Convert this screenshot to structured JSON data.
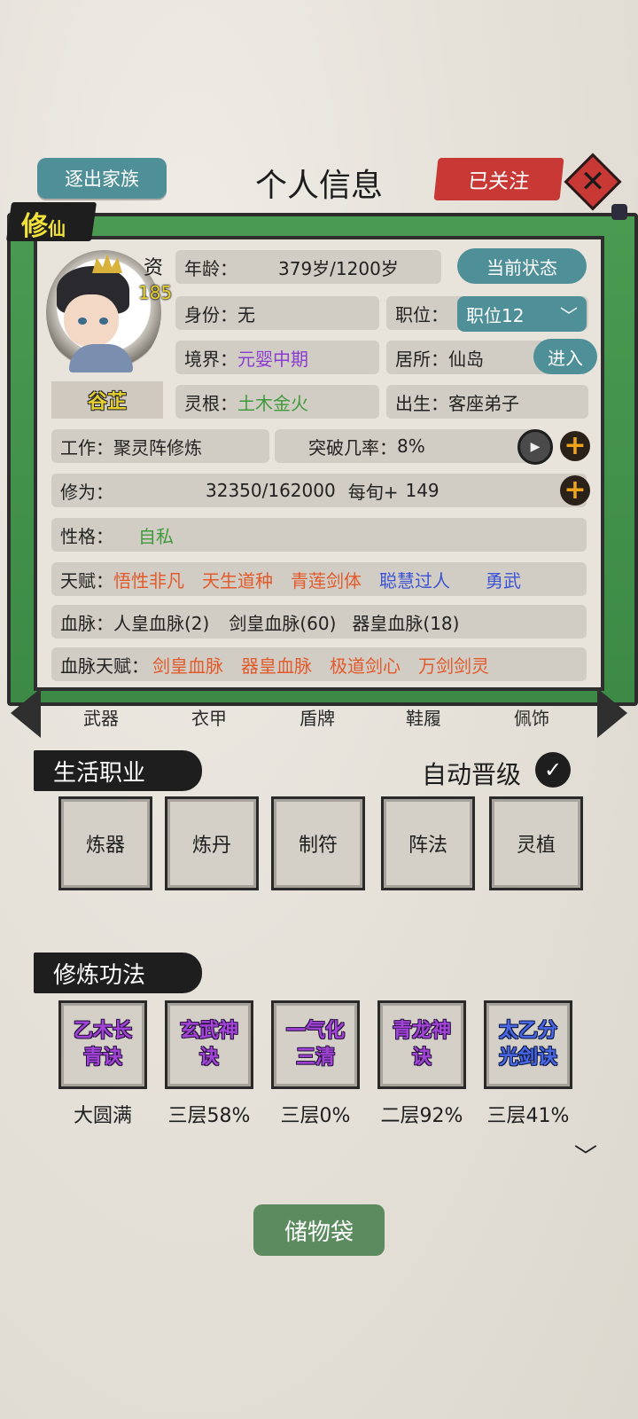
{
  "header": {
    "expel_label": "逐出家族",
    "title": "个人信息",
    "followed_label": "已关注",
    "close_icon": "close-icon"
  },
  "badge": {
    "main": "修",
    "sub": "仙"
  },
  "profile": {
    "aptitude_label": "资",
    "aptitude_value": "185",
    "name": "谷芷",
    "age_label": "年龄：",
    "age_value": "379岁/1200岁",
    "status_button": "当前状态",
    "identity_label": "身份：",
    "identity_value": "无",
    "position_label": "职位：",
    "position_value": "职位12",
    "realm_label": "境界：",
    "realm_value": "元婴中期",
    "residence_label": "居所：",
    "residence_value": "仙岛",
    "enter_button": "进入",
    "root_label": "灵根：",
    "root_value": "土木金火",
    "origin_label": "出生：",
    "origin_value": "客座弟子",
    "work_label": "工作：",
    "work_value": "聚灵阵修炼",
    "breakthrough_label": "突破几率：",
    "breakthrough_value": "8%",
    "cultivation_label": "修为：",
    "cultivation_value": "32350/162000",
    "per_period_label": "每旬+",
    "per_period_value": "149",
    "personality_label": "性格：",
    "personality_value": "自私",
    "talent_label": "天赋：",
    "talents": [
      {
        "text": "悟性非凡",
        "color": "#e25a2c"
      },
      {
        "text": "天生道种",
        "color": "#e25a2c"
      },
      {
        "text": "青莲剑体",
        "color": "#e25a2c"
      },
      {
        "text": "聪慧过人",
        "color": "#3b52d6"
      },
      {
        "text": "勇武",
        "color": "#3b52d6"
      }
    ],
    "bloodline_label": "血脉：",
    "bloodlines": [
      "人皇血脉(2)",
      "剑皇血脉(60)",
      "器皇血脉(18)"
    ],
    "bloodline_talent_label": "血脉天赋：",
    "bloodline_talents": [
      "剑皇血脉",
      "器皇血脉",
      "极道剑心",
      "万剑剑灵"
    ]
  },
  "equipment_tabs": [
    "武器",
    "衣甲",
    "盾牌",
    "鞋履",
    "佩饰"
  ],
  "life_jobs": {
    "header": "生活职业",
    "auto_upgrade_label": "自动晋级",
    "auto_upgrade_checked": true,
    "items": [
      "炼器",
      "炼丹",
      "制符",
      "阵法",
      "灵植"
    ]
  },
  "techniques": {
    "header": "修炼功法",
    "items": [
      {
        "name": "乙木长青诀",
        "level": "大圆满",
        "color": "#a344d8"
      },
      {
        "name": "玄武神诀",
        "level": "三层58%",
        "color": "#a344d8"
      },
      {
        "name": "一气化三清",
        "level": "三层0%",
        "color": "#a344d8"
      },
      {
        "name": "青龙神诀",
        "level": "二层92%",
        "color": "#a344d8"
      },
      {
        "name": "太乙分光剑诀",
        "level": "三层41%",
        "color": "#4a68e6"
      }
    ]
  },
  "storage_bag_label": "储物袋"
}
